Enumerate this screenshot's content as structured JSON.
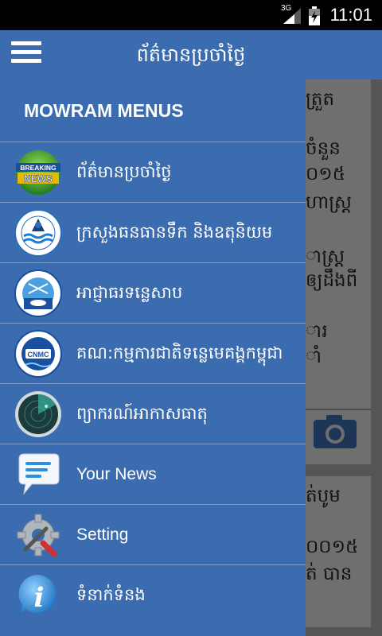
{
  "status_bar": {
    "network": "3G",
    "time": "11:01"
  },
  "app_bar": {
    "title": "ព័ត៌មានប្រចាំថ្ងៃ",
    "menu_icon": "hamburger-icon"
  },
  "drawer": {
    "header": "MOWRAM MENUS",
    "items": [
      {
        "label": "ព័ត៌មានប្រចាំថ្ងៃ",
        "icon": "breaking-news-icon"
      },
      {
        "label": "ក្រសួងធនធានទឹក និងឧតុនិយម",
        "icon": "mowram-logo-icon"
      },
      {
        "label": "អាជ្ញាធរទន្លេសាប",
        "icon": "tonle-sap-authority-icon"
      },
      {
        "label": "គណ:កម្មការជាតិទន្លេមេគង្គកម្ពុជា",
        "icon": "cnmc-logo-icon"
      },
      {
        "label": "ព្យាករណ៍អាកាសធាតុ",
        "icon": "radar-icon"
      },
      {
        "label": "Your News",
        "icon": "speech-bubble-icon"
      },
      {
        "label": "Setting",
        "icon": "settings-gear-icon"
      },
      {
        "label": "ទំនាក់ទំនង",
        "icon": "info-icon"
      }
    ]
  },
  "background_cards": {
    "card1_lines": [
      "ត្រួត",
      "ចំនួន",
      "០១៥",
      "ហាស្ត្រ",
      "",
      "ាស្ត្រ",
      "ឲ្យដឹងពី",
      "",
      "ារ",
      "ាំ"
    ],
    "card2_lines": [
      "ត់បូម",
      "",
      "០០១៥",
      "ត់ បាន"
    ]
  }
}
